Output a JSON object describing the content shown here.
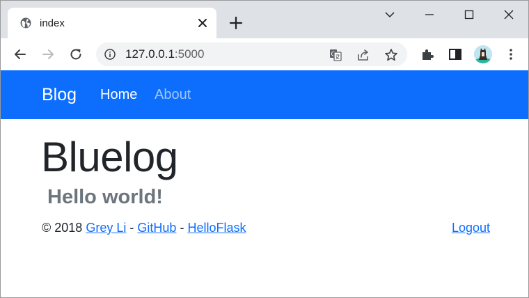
{
  "browser": {
    "tab": {
      "title": "index"
    },
    "address": {
      "host": "127.0.0.1",
      "port": ":5000"
    }
  },
  "navbar": {
    "brand": "Blog",
    "links": [
      {
        "label": "Home",
        "active": true
      },
      {
        "label": "About",
        "active": false
      }
    ]
  },
  "main": {
    "heading": "Bluelog",
    "subheading": "Hello world!"
  },
  "footer": {
    "copyright": "© 2018",
    "author_link": "Grey Li",
    "separator": "-",
    "github_link": "GitHub",
    "helloflask_link": "HelloFlask",
    "logout_link": "Logout"
  },
  "colors": {
    "navbar_bg": "#0d6efd",
    "link": "#0d6efd",
    "subheading": "#6c757d",
    "tabstrip_bg": "#dee1e6"
  },
  "icons": {
    "tab_favicon": "globe-icon",
    "tab_close": "close-icon",
    "new_tab": "plus-icon",
    "back": "arrow-left-icon",
    "forward": "arrow-right-icon",
    "reload": "reload-icon",
    "site_info": "info-icon",
    "translate": "translate-icon",
    "share": "share-icon",
    "bookmark": "star-icon",
    "extensions": "puzzle-icon",
    "side_panel": "side-panel-icon",
    "menu": "kebab-menu-icon"
  }
}
